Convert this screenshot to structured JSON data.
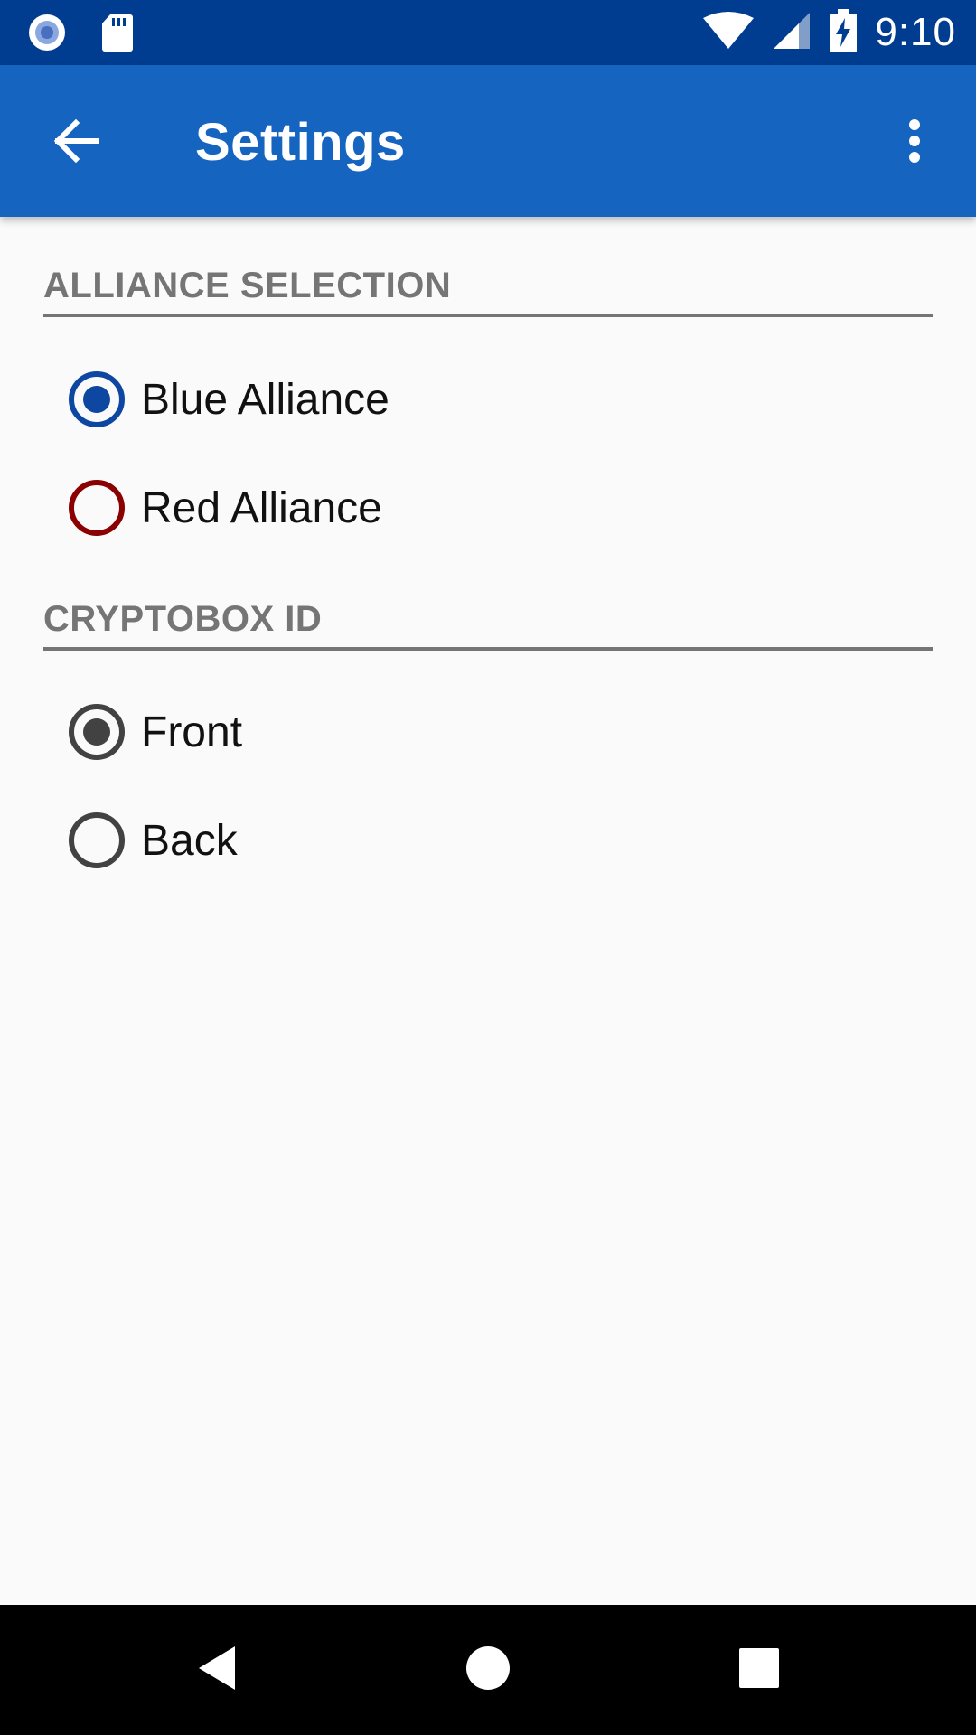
{
  "status_bar": {
    "time": "9:10",
    "icons": [
      "record-icon",
      "sd-card-icon",
      "wifi-icon",
      "cell-signal-icon",
      "battery-charging-icon"
    ]
  },
  "app_bar": {
    "title": "Settings",
    "back_icon": "arrow-back-icon",
    "menu_icon": "more-vert-icon",
    "color": "#1565c0"
  },
  "sections": [
    {
      "title": "ALLIANCE SELECTION",
      "options": [
        {
          "label": "Blue Alliance",
          "selected": true,
          "color": "#0d47a1"
        },
        {
          "label": "Red Alliance",
          "selected": false,
          "color": "#8b0000"
        }
      ]
    },
    {
      "title": "CRYPTOBOX ID",
      "options": [
        {
          "label": "Front",
          "selected": true,
          "color": "#424242"
        },
        {
          "label": "Back",
          "selected": false,
          "color": "#424242"
        }
      ]
    }
  ],
  "nav_bar": {
    "icons": [
      "nav-back-icon",
      "nav-home-icon",
      "nav-recents-icon"
    ]
  }
}
